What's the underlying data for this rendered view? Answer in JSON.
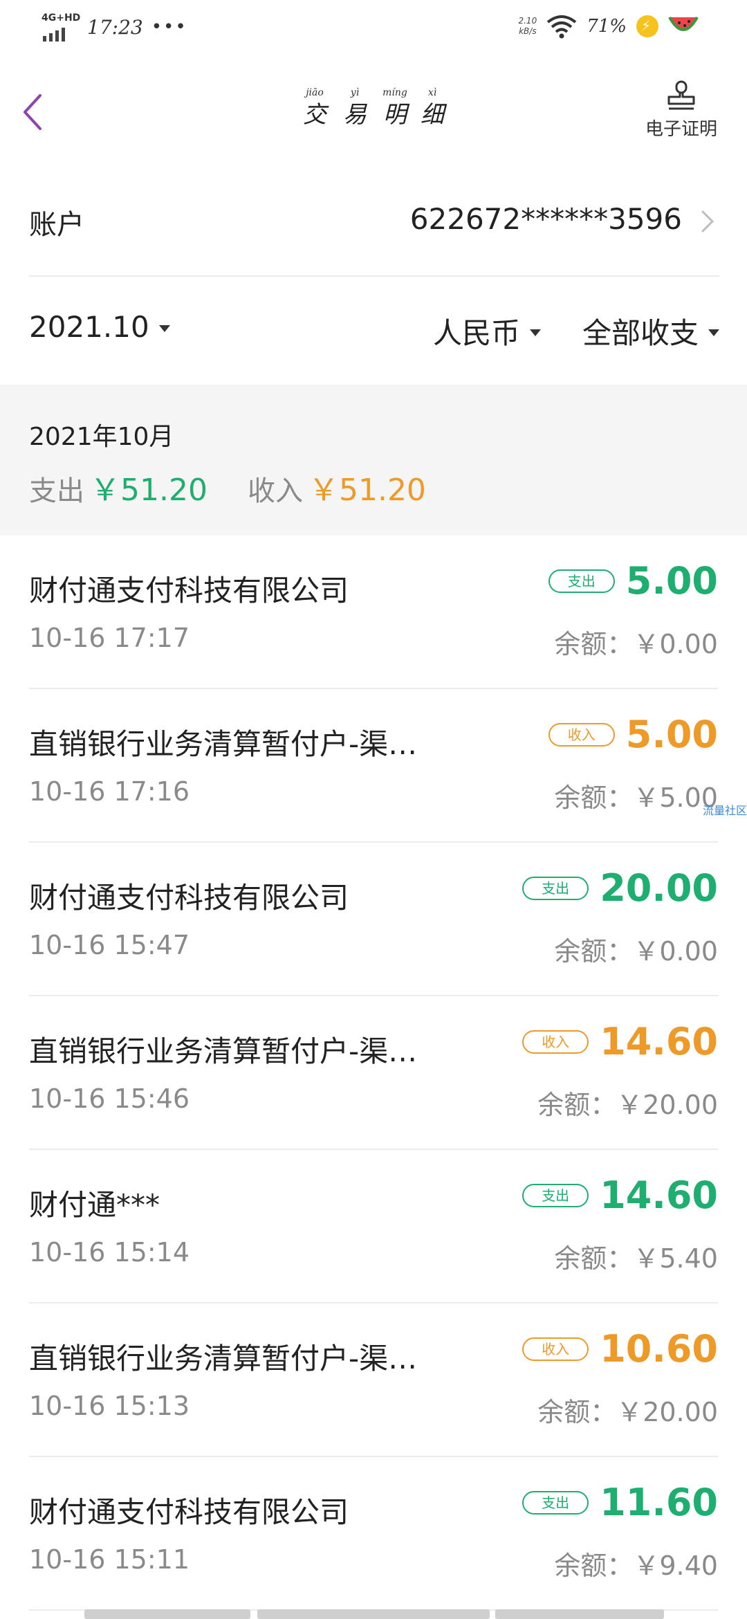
{
  "status_bar": {
    "network": "4G+HD",
    "time": "17:23",
    "more": "•••",
    "speed_value": "2.10",
    "speed_unit": "kB/s",
    "battery": "71%"
  },
  "nav": {
    "title_chars": [
      {
        "pinyin": "jiāo",
        "hanzi": "交"
      },
      {
        "pinyin": "yì",
        "hanzi": "易"
      },
      {
        "pinyin": "míng",
        "hanzi": "明"
      },
      {
        "pinyin": "xì",
        "hanzi": "细"
      }
    ],
    "certificate_label": "电子证明"
  },
  "account": {
    "label": "账户",
    "number": "622672******3596"
  },
  "filters": {
    "month": "2021.10",
    "currency": "人民币",
    "type": "全部收支"
  },
  "summary": {
    "month_label": "2021年10月",
    "expense_label": "支出",
    "expense_value": "￥51.20",
    "income_label": "收入",
    "income_value": "￥51.20"
  },
  "transactions": [
    {
      "name": "财付通支付科技有限公司",
      "time": "10-16 17:17",
      "type_label": "支出",
      "amount": "5.00",
      "balance": "余额：￥0.00"
    },
    {
      "name": "直销银行业务清算暂付户-渠…",
      "time": "10-16 17:16",
      "type_label": "收入",
      "amount": "5.00",
      "balance": "余额：￥5.00"
    },
    {
      "name": "财付通支付科技有限公司",
      "time": "10-16 15:47",
      "type_label": "支出",
      "amount": "20.00",
      "balance": "余额：￥0.00"
    },
    {
      "name": "直销银行业务清算暂付户-渠…",
      "time": "10-16 15:46",
      "type_label": "收入",
      "amount": "14.60",
      "balance": "余额：￥20.00"
    },
    {
      "name": "财付通***",
      "time": "10-16 15:14",
      "type_label": "支出",
      "amount": "14.60",
      "balance": "余额：￥5.40"
    },
    {
      "name": "直销银行业务清算暂付户-渠…",
      "time": "10-16 15:13",
      "type_label": "收入",
      "amount": "10.60",
      "balance": "余额：￥20.00"
    },
    {
      "name": "财付通支付科技有限公司",
      "time": "10-16 15:11",
      "type_label": "支出",
      "amount": "11.60",
      "balance": "余额：￥9.40"
    }
  ],
  "watermark": "流量社区",
  "colors": {
    "expense": "#1dae70",
    "income": "#ee9a28",
    "accent_back": "#8e44ad",
    "summary_bg": "#f5f5f5"
  },
  "icons": [
    "back-arrow-icon",
    "stamp-icon",
    "chevron-right-icon",
    "dropdown-triangle-icon",
    "wifi-icon",
    "signal-icon",
    "charging-icon",
    "watermelon-icon"
  ]
}
